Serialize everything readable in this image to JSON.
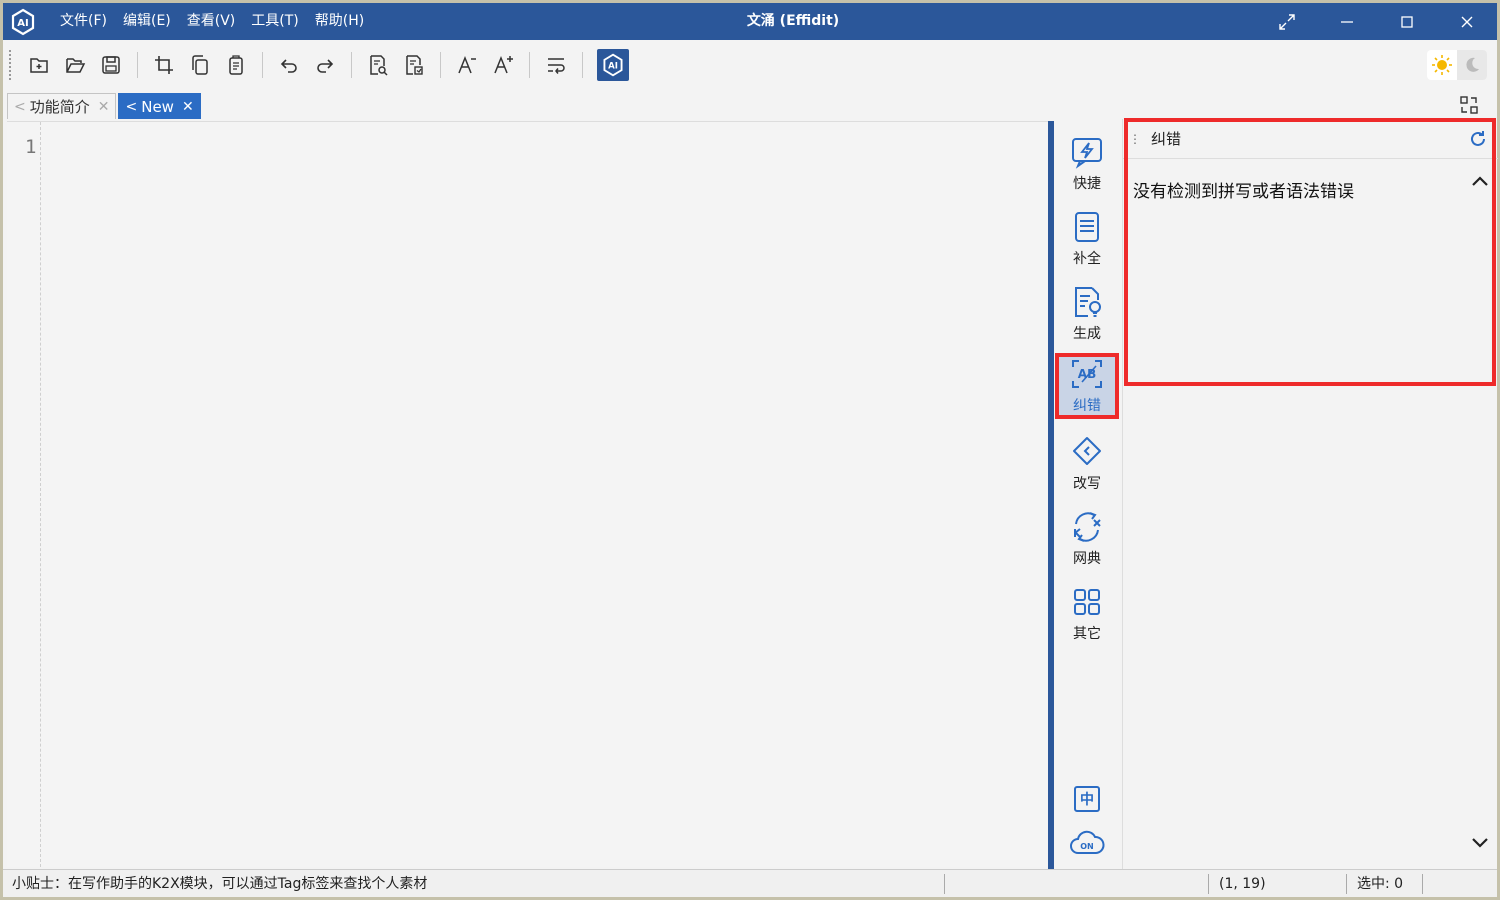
{
  "window": {
    "title": "文涌 (Effidit)"
  },
  "menu": [
    {
      "label": "文件(F)"
    },
    {
      "label": "编辑(E)"
    },
    {
      "label": "查看(V)"
    },
    {
      "label": "工具(T)"
    },
    {
      "label": "帮助(H)"
    }
  ],
  "tabs": [
    {
      "label": "功能简介",
      "active": false
    },
    {
      "label": "New",
      "active": true
    }
  ],
  "editor": {
    "line_numbers": [
      "1"
    ]
  },
  "side_tools": [
    {
      "label": "快捷",
      "icon": "lightning-icon"
    },
    {
      "label": "补全",
      "icon": "document-list-icon"
    },
    {
      "label": "生成",
      "icon": "document-bulb-icon"
    },
    {
      "label": "纠错",
      "icon": "ab-scan-icon",
      "active": true
    },
    {
      "label": "改写",
      "icon": "diamond-icon"
    },
    {
      "label": "网典",
      "icon": "knowledge-icon"
    },
    {
      "label": "其它",
      "icon": "grid-icon"
    }
  ],
  "side_bottom": {
    "lang_label": "中",
    "cloud_label": "ON"
  },
  "panel": {
    "title": "纠错",
    "message": "没有检测到拼写或者语法错误"
  },
  "status": {
    "tip": "小贴士：在写作助手的K2X模块，可以通过Tag标签来查找个人素材",
    "position": "(1, 19)",
    "selection": "选中: 0"
  },
  "colors": {
    "title_bar": "#2b579a",
    "accent": "#2b6cc4",
    "highlight": "#ee2a2a"
  }
}
